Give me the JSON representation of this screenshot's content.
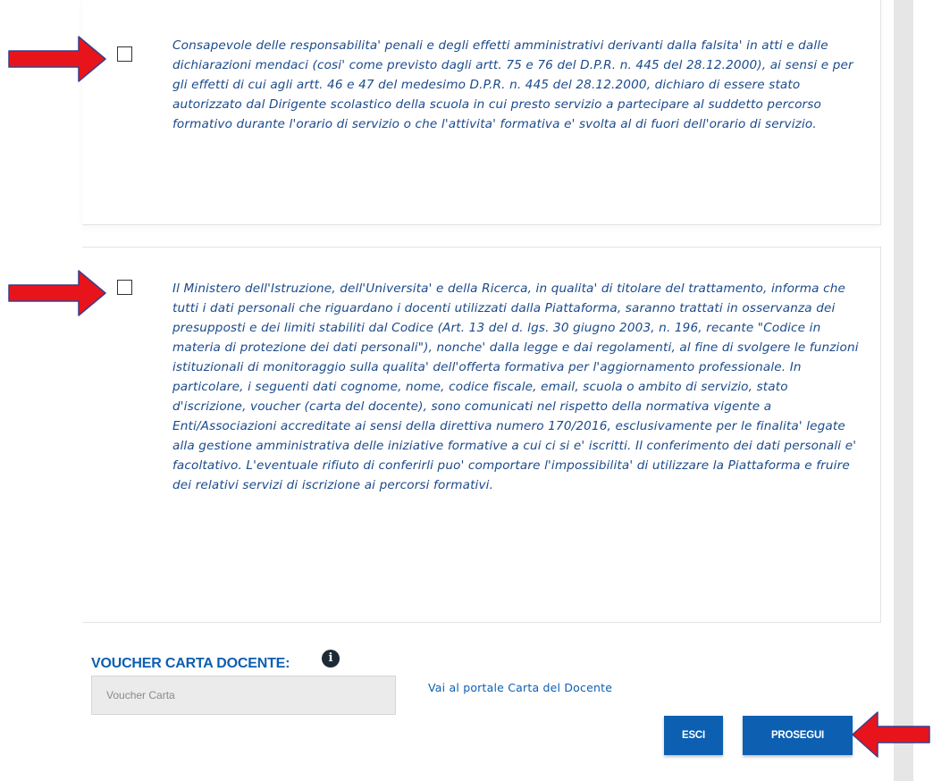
{
  "declarations": [
    {
      "checked": false,
      "text": "Consapevole delle responsabilita' penali e degli effetti amministrativi derivanti dalla falsita' in atti e dalle dichiarazioni mendaci (cosi' come previsto dagli artt. 75 e 76 del D.P.R. n. 445 del 28.12.2000), ai sensi e per gli effetti di cui agli artt. 46 e 47 del medesimo D.P.R. n. 445 del 28.12.2000, dichiaro di essere stato autorizzato dal Dirigente scolastico della scuola in cui presto servizio a partecipare al suddetto percorso formativo durante l'orario di servizio o che l'attivita' formativa e' svolta al di fuori dell'orario di servizio."
    },
    {
      "checked": false,
      "text": "Il Ministero dell'Istruzione, dell'Universita' e della Ricerca, in qualita' di titolare del trattamento, informa che tutti i dati personali che riguardano i docenti utilizzati dalla Piattaforma, saranno trattati in osservanza dei presupposti e dei limiti stabiliti dal Codice (Art. 13 del d. lgs. 30 giugno 2003, n. 196, recante \"Codice in materia di protezione dei dati personali\"), nonche' dalla legge e dai regolamenti, al fine di svolgere le funzioni istituzionali di monitoraggio sulla qualita' dell'offerta formativa per l'aggiornamento professionale. In particolare, i seguenti dati cognome, nome, codice fiscale, email, scuola o ambito di servizio, stato d'iscrizione, voucher (carta del docente), sono comunicati nel rispetto della normativa vigente a Enti/Associazioni accreditate ai sensi della direttiva numero 170/2016, esclusivamente per le finalita' legate alla gestione amministrativa delle iniziative formative a cui ci si e' iscritti. Il conferimento dei dati personali e' facoltativo. L'eventuale rifiuto di conferirli puo' comportare l'impossibilita' di utilizzare la Piattaforma e fruire dei relativi servizi di iscrizione ai percorsi formativi."
    }
  ],
  "voucher": {
    "label": "VOUCHER CARTA DOCENTE:",
    "info_icon": "info-icon",
    "input_value": "",
    "input_placeholder": "Voucher Carta",
    "portal_link": "Vai al portale Carta del Docente"
  },
  "actions": {
    "exit_label": "ESCI",
    "continue_label": "PROSEGUI"
  },
  "annotations": {
    "arrow_icon": "red-arrow-icon",
    "arrow_color": "#e8141b"
  },
  "colors": {
    "primary": "#0d5fb1",
    "declaration_text": "#1b4a8a"
  }
}
